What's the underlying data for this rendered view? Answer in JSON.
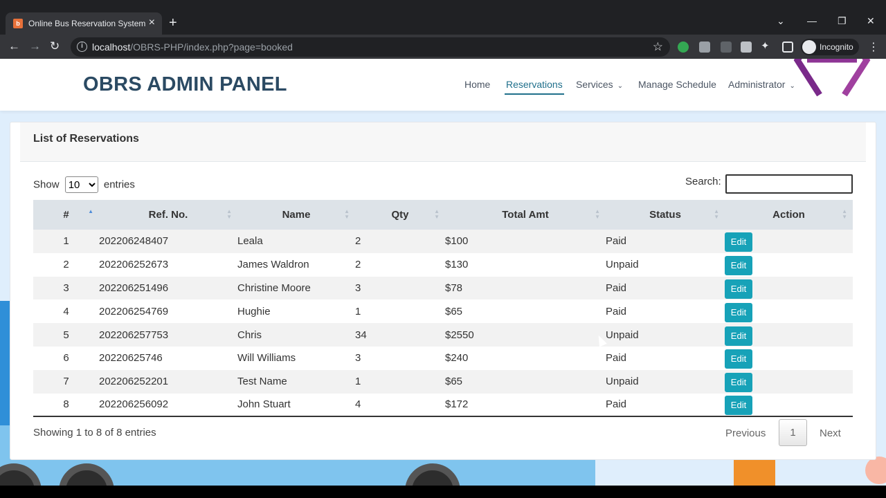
{
  "browser": {
    "tab_title": "Online Bus Reservation System",
    "url_host": "localhost",
    "url_path": "/OBRS-PHP/index.php?page=booked",
    "profile_label": "Incognito"
  },
  "navbar": {
    "brand": "OBRS ADMIN PANEL",
    "links": [
      "Home",
      "Reservations",
      "Services",
      "Manage Schedule",
      "Administrator"
    ],
    "active": "Reservations"
  },
  "card": {
    "title": "List of Reservations",
    "show_label": "Show",
    "entries_label": "entries",
    "page_size": "10",
    "search_label": "Search:",
    "search_value": ""
  },
  "table": {
    "columns": [
      "#",
      "Ref. No.",
      "Name",
      "Qty",
      "Total Amt",
      "Status",
      "Action"
    ],
    "rows": [
      {
        "n": "1",
        "ref": "202206248407",
        "name": "Leala",
        "qty": "2",
        "amt": "$100",
        "status": "Paid",
        "action": "Edit"
      },
      {
        "n": "2",
        "ref": "202206252673",
        "name": "James Waldron",
        "qty": "2",
        "amt": "$130",
        "status": "Unpaid",
        "action": "Edit"
      },
      {
        "n": "3",
        "ref": "202206251496",
        "name": "Christine Moore",
        "qty": "3",
        "amt": "$78",
        "status": "Paid",
        "action": "Edit"
      },
      {
        "n": "4",
        "ref": "202206254769",
        "name": "Hughie",
        "qty": "1",
        "amt": "$65",
        "status": "Paid",
        "action": "Edit"
      },
      {
        "n": "5",
        "ref": "202206257753",
        "name": "Chris",
        "qty": "34",
        "amt": "$2550",
        "status": "Unpaid",
        "action": "Edit"
      },
      {
        "n": "6",
        "ref": "20220625746",
        "name": "Will Williams",
        "qty": "3",
        "amt": "$240",
        "status": "Paid",
        "action": "Edit"
      },
      {
        "n": "7",
        "ref": "202206252201",
        "name": "Test Name",
        "qty": "1",
        "amt": "$65",
        "status": "Unpaid",
        "action": "Edit"
      },
      {
        "n": "8",
        "ref": "202206256092",
        "name": "John Stuart",
        "qty": "4",
        "amt": "$172",
        "status": "Paid",
        "action": "Edit"
      }
    ]
  },
  "footer": {
    "info": "Showing 1 to 8 of 8 entries",
    "prev": "Previous",
    "current": "1",
    "next": "Next"
  },
  "colors": {
    "brand": "#2b4a63",
    "active_link": "#1f6f8b",
    "edit_button": "#17a2b8",
    "header_row": "#dde3e8"
  }
}
